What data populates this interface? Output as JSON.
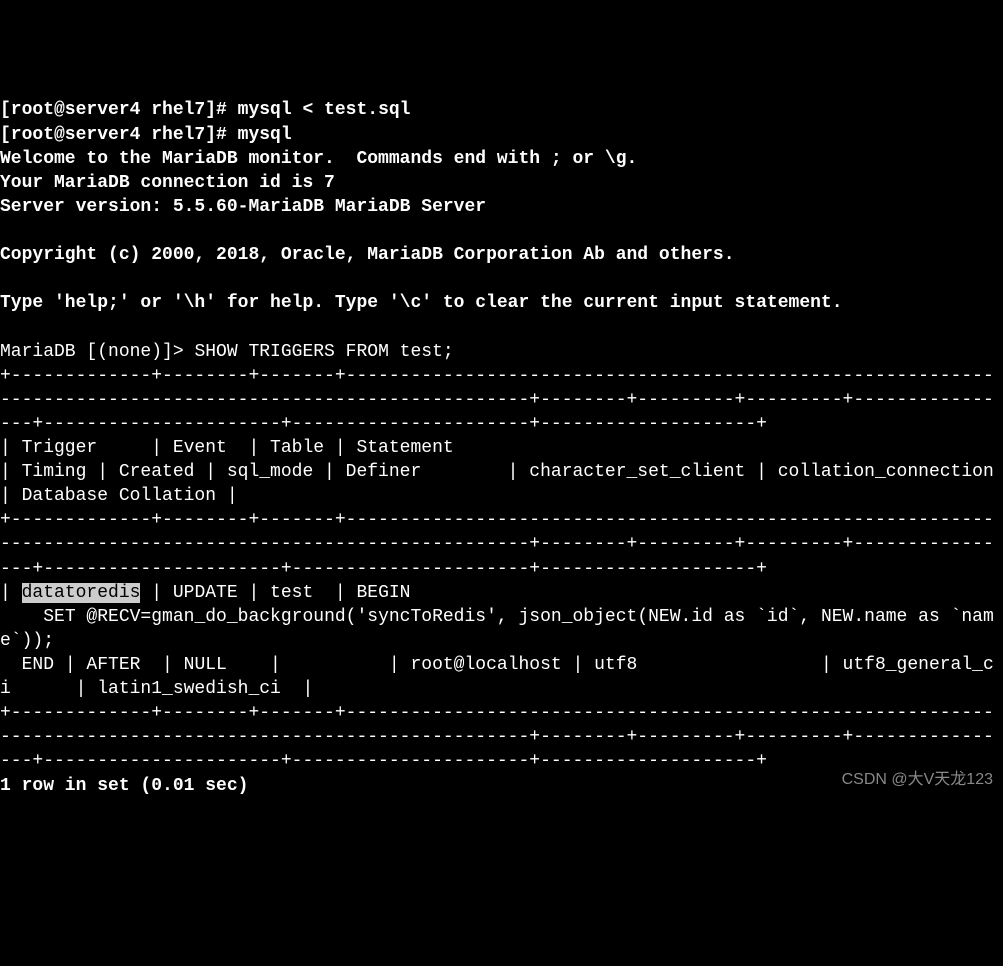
{
  "terminal": {
    "prompt1": "[root@server4 rhel7]# ",
    "command1": "mysql < test.sql",
    "prompt2": "[root@server4 rhel7]# ",
    "command2": "mysql",
    "welcome1": "Welcome to the MariaDB monitor.  Commands end with ; or \\g.",
    "welcome2": "Your MariaDB connection id is 7",
    "welcome3": "Server version: 5.5.60-MariaDB MariaDB Server",
    "copyright": "Copyright (c) 2000, 2018, Oracle, MariaDB Corporation Ab and others.",
    "help": "Type 'help;' or '\\h' for help. Type '\\c' to clear the current input statement.",
    "mariaprompt": "MariaDB [(none)]> ",
    "query": "SHOW TRIGGERS FROM test;",
    "separator": "+-------------+--------+-------+-------------------------------------------------------------------------------------------------------------+--------+---------+---------+----------------+----------------------+----------------------+--------------------+",
    "header": "| Trigger     | Event  | Table | Statement                                                                                                   | Timing | Created | sql_mode | Definer        | character_set_client | collation_connection | Database Collation |",
    "row_prefix": "| ",
    "row_highlight": "datatoredis",
    "row_part1": " | UPDATE | test  | BEGIN",
    "row_part2": "    SET @RECV=gman_do_background('syncToRedis', json_object(NEW.id as `id`, NEW.name as `name`));",
    "row_part3": "  END | AFTER  | NULL    |          | root@localhost | utf8                 | utf8_general_ci      | latin1_swedish_ci  |",
    "result": "1 row in set (0.01 sec)"
  },
  "watermark": "CSDN @大V天龙123"
}
